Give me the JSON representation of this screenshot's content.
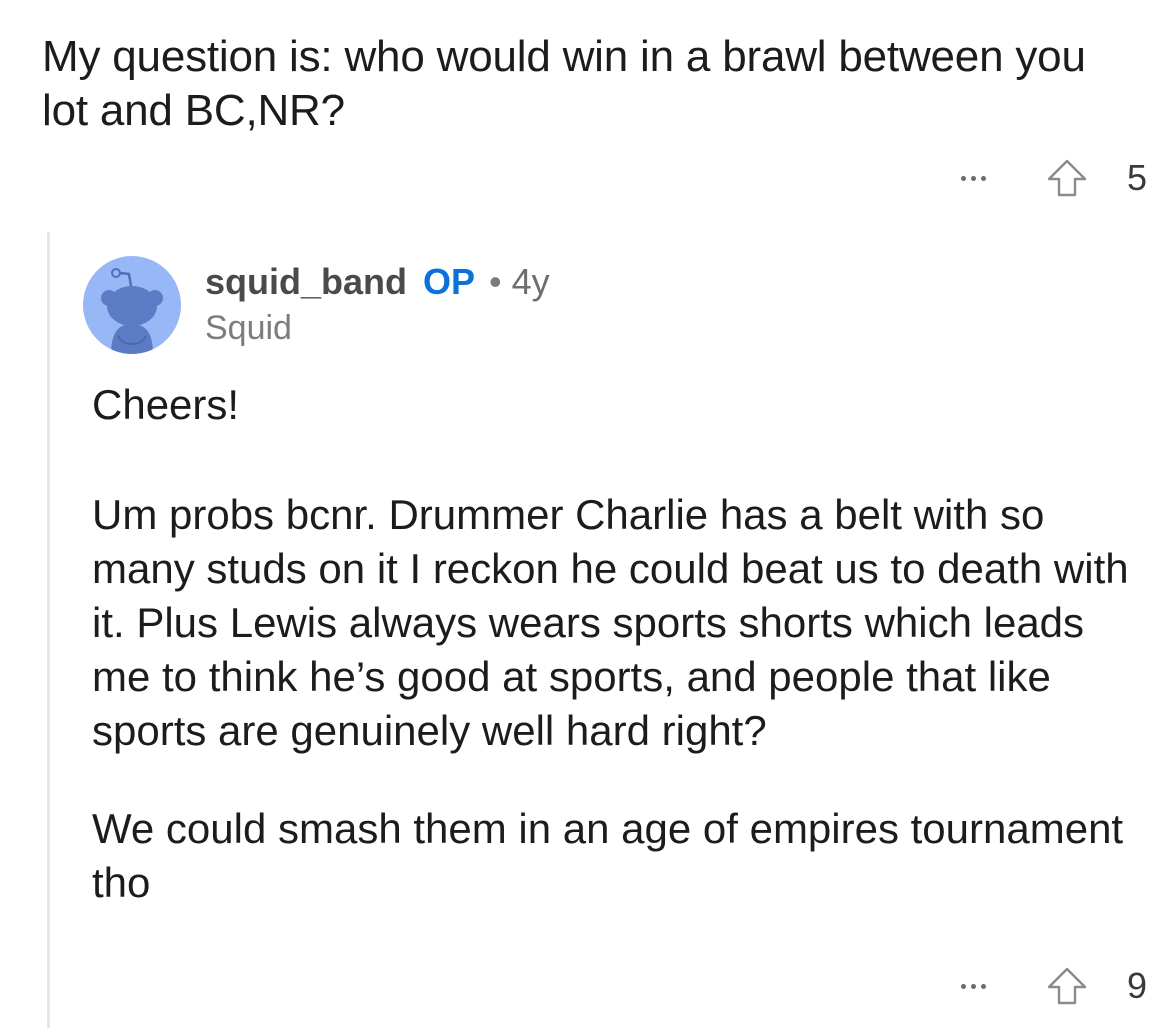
{
  "parent_comment": {
    "body": "My question is: who would win in a brawl between you lot and BC,NR?",
    "actions": {
      "more_icon": "more-dots-icon",
      "upvote_icon": "upvote-arrow-icon",
      "score": "5"
    }
  },
  "reply": {
    "avatar_icon": "reddit-snoo-avatar",
    "author": "squid_band",
    "op_badge": "OP",
    "separator": "•",
    "age": "4y",
    "flair": "Squid",
    "paragraphs": [
      "Cheers!",
      "Um probs bcnr. Drummer Charlie has a belt with so many studs on it I reckon he could beat us to death with it. Plus Lewis always wears sports shorts which leads me to think he’s good at sports, and people that like sports are genuinely well hard right?",
      "We could smash them in an age of empires tournament tho"
    ],
    "actions": {
      "more_icon": "more-dots-icon",
      "upvote_icon": "upvote-arrow-icon",
      "score": "9"
    }
  },
  "colors": {
    "op_badge": "#0a72d8",
    "avatar_bg": "#97b7f6",
    "avatar_figure": "#5b7cc4",
    "thread_line": "#e6e6e6"
  }
}
